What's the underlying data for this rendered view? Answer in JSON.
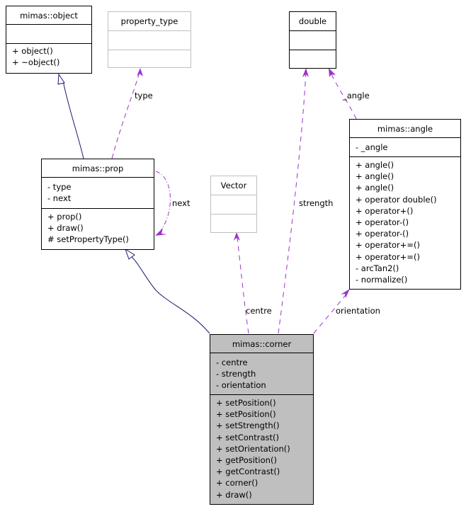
{
  "classes": {
    "object": {
      "name": "mimas::object",
      "attributes": [],
      "methods": [
        "+ object()",
        "+ ~object()"
      ]
    },
    "property_type": {
      "name": "property_type",
      "attributes": [],
      "methods": []
    },
    "double": {
      "name": "double",
      "attributes": [],
      "methods": []
    },
    "angle": {
      "name": "mimas::angle",
      "attributes": [
        "- _angle"
      ],
      "methods": [
        "+ angle()",
        "+ angle()",
        "+ angle()",
        "+ operator double()",
        "+ operator+()",
        "+ operator-()",
        "+ operator-()",
        "+ operator+=()",
        "+ operator+=()",
        "- arcTan2()",
        "- normalize()"
      ]
    },
    "prop": {
      "name": "mimas::prop",
      "attributes": [
        "- type",
        "- next"
      ],
      "methods": [
        "+ prop()",
        "+ draw()",
        "# setPropertyType()"
      ]
    },
    "vector": {
      "name": "Vector",
      "attributes": [],
      "methods": []
    },
    "corner": {
      "name": "mimas::corner",
      "attributes": [
        "- centre",
        "- strength",
        "- orientation"
      ],
      "methods": [
        "+ setPosition()",
        "+ setPosition()",
        "+ setStrength()",
        "+ setContrast()",
        "+ setOrientation()",
        "+ getPosition()",
        "+ getContrast()",
        "+ corner()",
        "+ draw()"
      ]
    }
  },
  "edge_labels": {
    "type": "type",
    "next": "next",
    "angle": "_angle",
    "strength": "strength",
    "centre": "centre",
    "orientation": "orientation"
  },
  "colors": {
    "inheritance": "#191970",
    "usage": "#9a32cd",
    "focus_fill": "#bfbfbf",
    "external_border": "#bfbfbf"
  }
}
